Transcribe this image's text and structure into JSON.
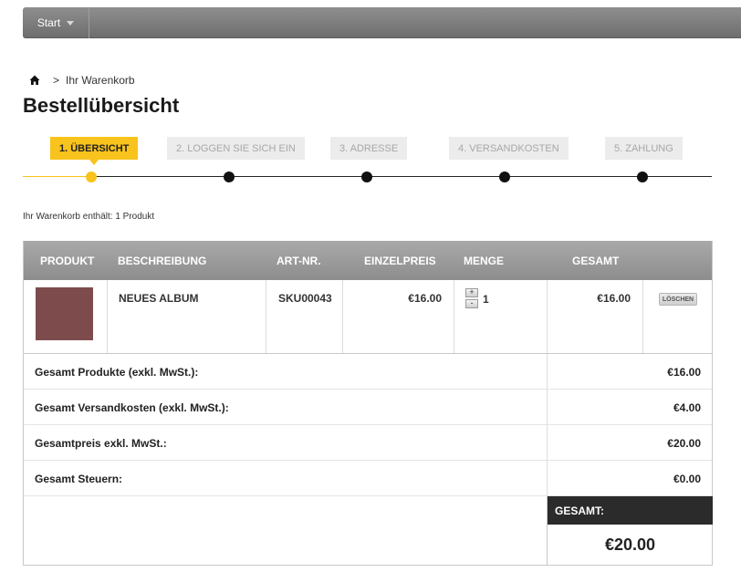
{
  "nav": {
    "start_label": "Start"
  },
  "breadcrumb": {
    "separator": ">",
    "current": "Ihr Warenkorb"
  },
  "page_title": "Bestellübersicht",
  "steps": [
    {
      "label": "1. ÜBERSICHT",
      "active": true
    },
    {
      "label": "2. LOGGEN SIE SICH EIN",
      "active": false
    },
    {
      "label": "3. ADRESSE",
      "active": false
    },
    {
      "label": "4. VERSANDKOSTEN",
      "active": false
    },
    {
      "label": "5. ZAHLUNG",
      "active": false
    }
  ],
  "cart_count": "Ihr Warenkorb enthält: 1 Produkt",
  "table": {
    "headers": [
      "PRODUKT",
      "BESCHREIBUNG",
      "ART-NR.",
      "EINZELPREIS",
      "MENGE",
      "GESAMT"
    ],
    "item": {
      "description": "NEUES ALBUM",
      "sku": "SKU00043",
      "unit_price": "€16.00",
      "quantity": "1",
      "qty_plus": "+",
      "qty_minus": "-",
      "total": "€16.00",
      "delete_label": "LÖSCHEN",
      "thumb_color": "#7d4b4b"
    }
  },
  "summary": [
    {
      "label": "Gesamt Produkte (exkl. MwSt.):",
      "value": "€16.00"
    },
    {
      "label": "Gesamt Versandkosten (exkl. MwSt.):",
      "value": "€4.00"
    },
    {
      "label": "Gesamtpreis exkl. MwSt.:",
      "value": "€20.00"
    },
    {
      "label": "Gesamt Steuern:",
      "value": "€0.00"
    }
  ],
  "total": {
    "label": "GESAMT:",
    "value": "€20.00"
  },
  "colors": {
    "accent": "#f8c31c",
    "header_gray": "#9a9a9a",
    "total_bg": "#2b2b2b"
  }
}
